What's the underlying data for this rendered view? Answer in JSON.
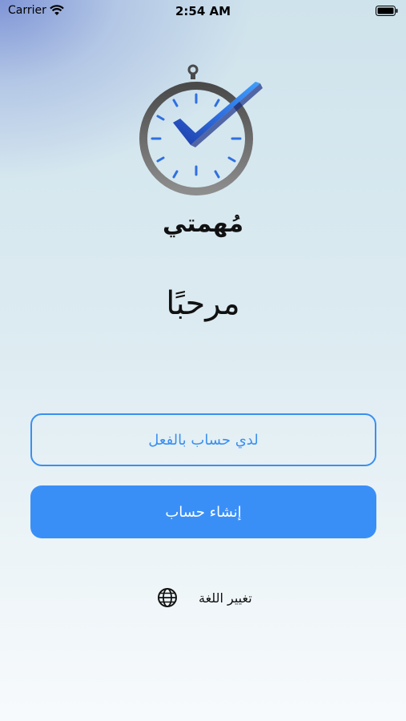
{
  "status_bar": {
    "carrier": "Carrier",
    "time": "2:54 AM"
  },
  "app": {
    "name": "مُهمتي"
  },
  "welcome": {
    "title": "مرحبًا"
  },
  "actions": {
    "login_label": "لدي حساب بالفعل",
    "signup_label": "إنشاء حساب"
  },
  "language": {
    "label": "تغيير اللغة",
    "icon": "globe-icon"
  },
  "colors": {
    "accent": "#3a8ff7",
    "logo_blue": "#2f6fe0"
  }
}
